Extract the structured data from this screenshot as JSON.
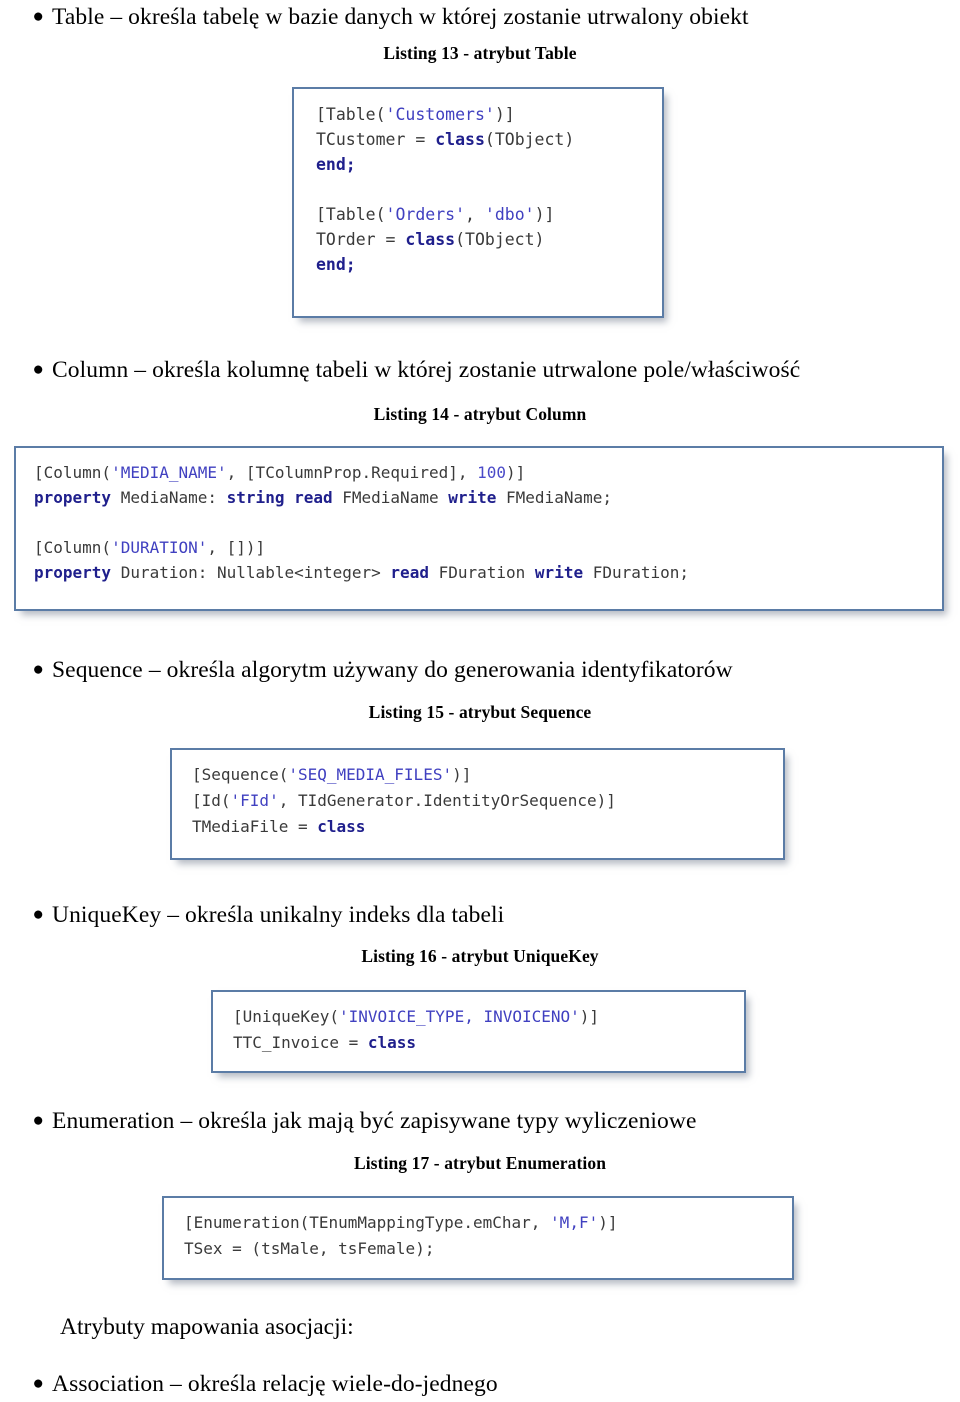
{
  "document": {
    "language": "pl",
    "bullet_glyph": "●",
    "accent_border_color": "#5b7ca6",
    "keyword_color": "#1f1f8c",
    "string_color": "#4040c0",
    "code_text_color": "#3a3a3a"
  },
  "sections": [
    {
      "id": "table",
      "bullet": "Table – określa tabelę w bazie danych w której zostanie utrwalony obiekt",
      "caption": "Listing 13 - atrybut Table",
      "code_lines": [
        "[Table('Customers')]",
        "TCustomer = class(TObject)",
        "end;",
        "",
        "[Table('Orders', 'dbo')]",
        "TOrder = class(TObject)",
        "end;"
      ]
    },
    {
      "id": "column",
      "bullet": "Column – określa kolumnę tabeli w której zostanie utrwalone pole/właściwość",
      "caption": "Listing 14  - atrybut Column",
      "code_lines": [
        "[Column('MEDIA_NAME', [TColumnProp.Required], 100)]",
        "property MediaName: string read FMediaName write FMediaName;",
        "",
        "[Column('DURATION', [])]",
        "property Duration: Nullable<integer> read FDuration write FDuration;"
      ]
    },
    {
      "id": "sequence",
      "bullet": "Sequence – określa algorytm używany do generowania identyfikatorów",
      "caption": "Listing 15 - atrybut Sequence",
      "code_lines": [
        "[Sequence('SEQ_MEDIA_FILES')]",
        "[Id('FId', TIdGenerator.IdentityOrSequence)]",
        "TMediaFile = class"
      ]
    },
    {
      "id": "uniquekey",
      "bullet": "UniqueKey – określa unikalny indeks dla tabeli",
      "caption": "Listing 16 - atrybut UniqueKey",
      "code_lines": [
        "[UniqueKey('INVOICE_TYPE, INVOICENO')]",
        "TTC_Invoice = class"
      ]
    },
    {
      "id": "enumeration",
      "bullet": "Enumeration – określa jak mają być zapisywane typy wyliczeniowe",
      "caption": "Listing 17 - atrybut Enumeration",
      "code_lines": [
        "[Enumeration(TEnumMappingType.emChar, 'M,F')]",
        "TSex = (tsMale, tsFemale);"
      ]
    }
  ],
  "footer": {
    "heading": "Atrybuty mapowania asocjacji:",
    "bullet": "Association – określa relację wiele-do-jednego"
  }
}
